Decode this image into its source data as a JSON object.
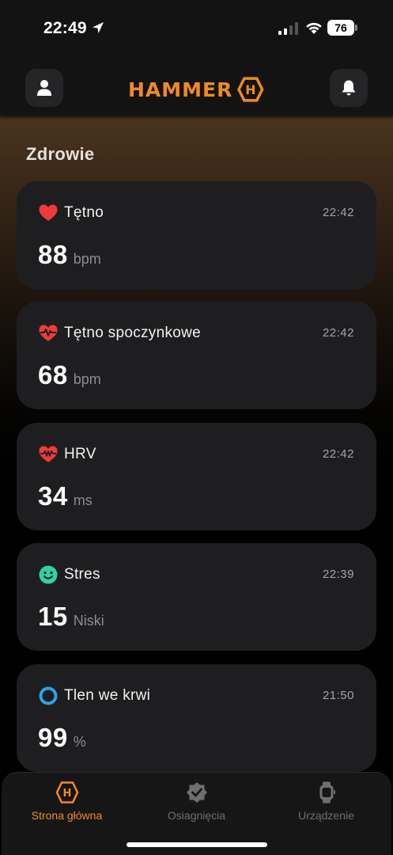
{
  "status_bar": {
    "time": "22:49",
    "battery": "76"
  },
  "header": {
    "logo_text": "HAMMER",
    "logo_mark_letter": "H"
  },
  "section": {
    "title": "Zdrowie"
  },
  "metrics": [
    {
      "title": "Tętno",
      "time": "22:42",
      "value": "88",
      "unit": "bpm",
      "icon": "heart-icon",
      "color": "#ef3b3b"
    },
    {
      "title": "Tętno spoczynkowe",
      "time": "22:42",
      "value": "68",
      "unit": "bpm",
      "icon": "heart-pulse-icon",
      "color": "#ef3b3b"
    },
    {
      "title": "HRV",
      "time": "22:42",
      "value": "34",
      "unit": "ms",
      "icon": "heart-wave-icon",
      "color": "#ef3b3b"
    },
    {
      "title": "Stres",
      "time": "22:39",
      "value": "15",
      "unit": "Niski",
      "icon": "smiley-icon",
      "color": "#2ed3a0"
    },
    {
      "title": "Tlen we krwi",
      "time": "21:50",
      "value": "99",
      "unit": "%",
      "icon": "ring-icon",
      "color": "#2f9fe8"
    }
  ],
  "tabs": [
    {
      "label": "Strona główna",
      "icon": "hammer-logo-icon",
      "active": true
    },
    {
      "label": "Osiagnięcia",
      "icon": "achievement-check-icon",
      "active": false
    },
    {
      "label": "Urządzenie",
      "icon": "watch-icon",
      "active": false
    }
  ],
  "colors": {
    "accent": "#f08a24",
    "card": "#1e1e20",
    "background": "#000000"
  }
}
